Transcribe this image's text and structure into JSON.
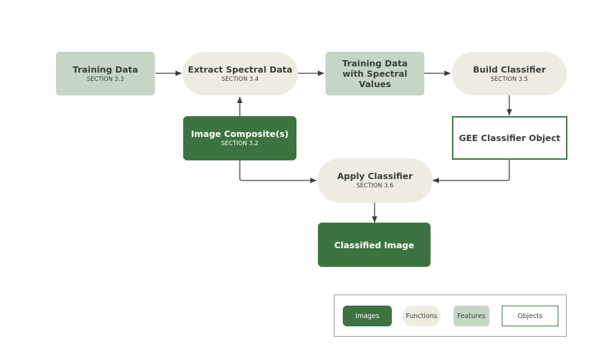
{
  "nodes": {
    "training_data": {
      "title": "Training Data",
      "section": "SECTION 3.3"
    },
    "extract_spectral": {
      "title": "Extract Spectral Data",
      "section": "SECTION 3.4"
    },
    "training_spectral": {
      "title": "Training Data with Spectral Values"
    },
    "build_classifier": {
      "title": "Build Classifier",
      "section": "SECTION 3.5"
    },
    "image_composite": {
      "title": "Image Composite(s)",
      "section": "SECTION 3.2"
    },
    "gee_classifier": {
      "title": "GEE Classifier Object"
    },
    "apply_classifier": {
      "title": "Apply Classifier",
      "section": "SECTION 3.6"
    },
    "classified_image": {
      "title": "Classified Image"
    }
  },
  "legend": {
    "images": "Images",
    "functions": "Functions",
    "features": "Features",
    "objects": "Objects"
  },
  "colors": {
    "images": "#3d7340",
    "functions": "#eeebe3",
    "features": "#c5d6c6",
    "objects_border": "#3d7340",
    "edge": "#3a3a3a"
  }
}
